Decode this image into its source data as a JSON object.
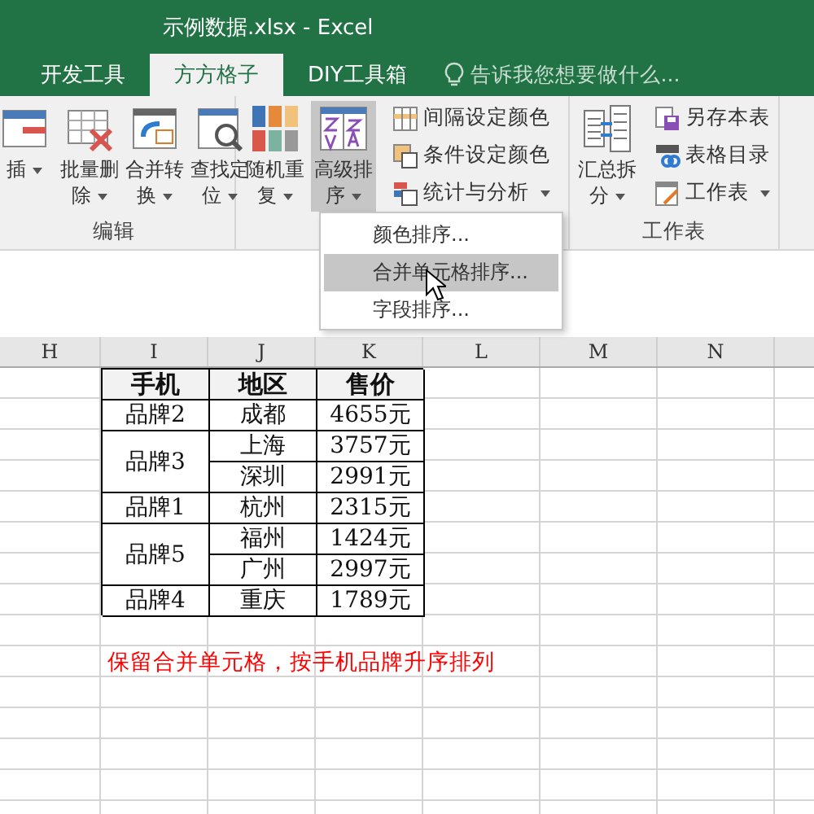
{
  "window": {
    "title": "示例数据.xlsx - Excel"
  },
  "tabs": [
    {
      "label": "开发工具",
      "selected": false
    },
    {
      "label": "方方格子",
      "selected": true
    },
    {
      "label": "DIY工具箱",
      "selected": false
    }
  ],
  "tell_me": {
    "placeholder": "告诉我您想要做什么..."
  },
  "ribbon": {
    "groups": [
      {
        "label": "编辑",
        "large": [
          {
            "label": "插",
            "caret": true,
            "pressed": false
          },
          {
            "label": "批量删除",
            "caret": true,
            "pressed": false
          },
          {
            "label": "合并转换",
            "caret": true,
            "pressed": false
          },
          {
            "label": "查找定位",
            "caret": true,
            "pressed": false
          }
        ]
      },
      {
        "large": [
          {
            "label": "随机重复",
            "caret": true,
            "pressed": false
          },
          {
            "label": "高级排序",
            "caret": true,
            "pressed": true
          }
        ],
        "small": [
          {
            "label": "间隔设定颜色",
            "caret": false
          },
          {
            "label": "条件设定颜色",
            "caret": false
          },
          {
            "label": "统计与分析",
            "caret": true
          }
        ]
      },
      {
        "label": "工作表",
        "large": [
          {
            "label": "汇总拆分",
            "caret": true,
            "pressed": false
          }
        ],
        "small": [
          {
            "label": "另存本表",
            "caret": false
          },
          {
            "label": "表格目录",
            "caret": false
          },
          {
            "label": "工作表",
            "caret": true
          }
        ]
      }
    ]
  },
  "menu": {
    "items": [
      {
        "label": "颜色排序...",
        "selected": false
      },
      {
        "label": "合并单元格排序...",
        "selected": true
      },
      {
        "label": "字段排序...",
        "selected": false
      }
    ]
  },
  "sheet": {
    "columns": [
      "H",
      "I",
      "J",
      "K",
      "L",
      "M",
      "N"
    ],
    "table": {
      "headers": [
        "手机",
        "地区",
        "售价"
      ],
      "groups": [
        {
          "brand": "品牌2",
          "rows": [
            {
              "region": "成都",
              "price": "4655元"
            }
          ]
        },
        {
          "brand": "品牌3",
          "rows": [
            {
              "region": "上海",
              "price": "3757元"
            },
            {
              "region": "深圳",
              "price": "2991元"
            }
          ]
        },
        {
          "brand": "品牌1",
          "rows": [
            {
              "region": "杭州",
              "price": "2315元"
            }
          ]
        },
        {
          "brand": "品牌5",
          "rows": [
            {
              "region": "福州",
              "price": "1424元"
            },
            {
              "region": "广州",
              "price": "2997元"
            }
          ]
        },
        {
          "brand": "品牌4",
          "rows": [
            {
              "region": "重庆",
              "price": "1789元"
            }
          ]
        }
      ]
    },
    "note": "保留合并单元格，按手机品牌升序排列"
  }
}
